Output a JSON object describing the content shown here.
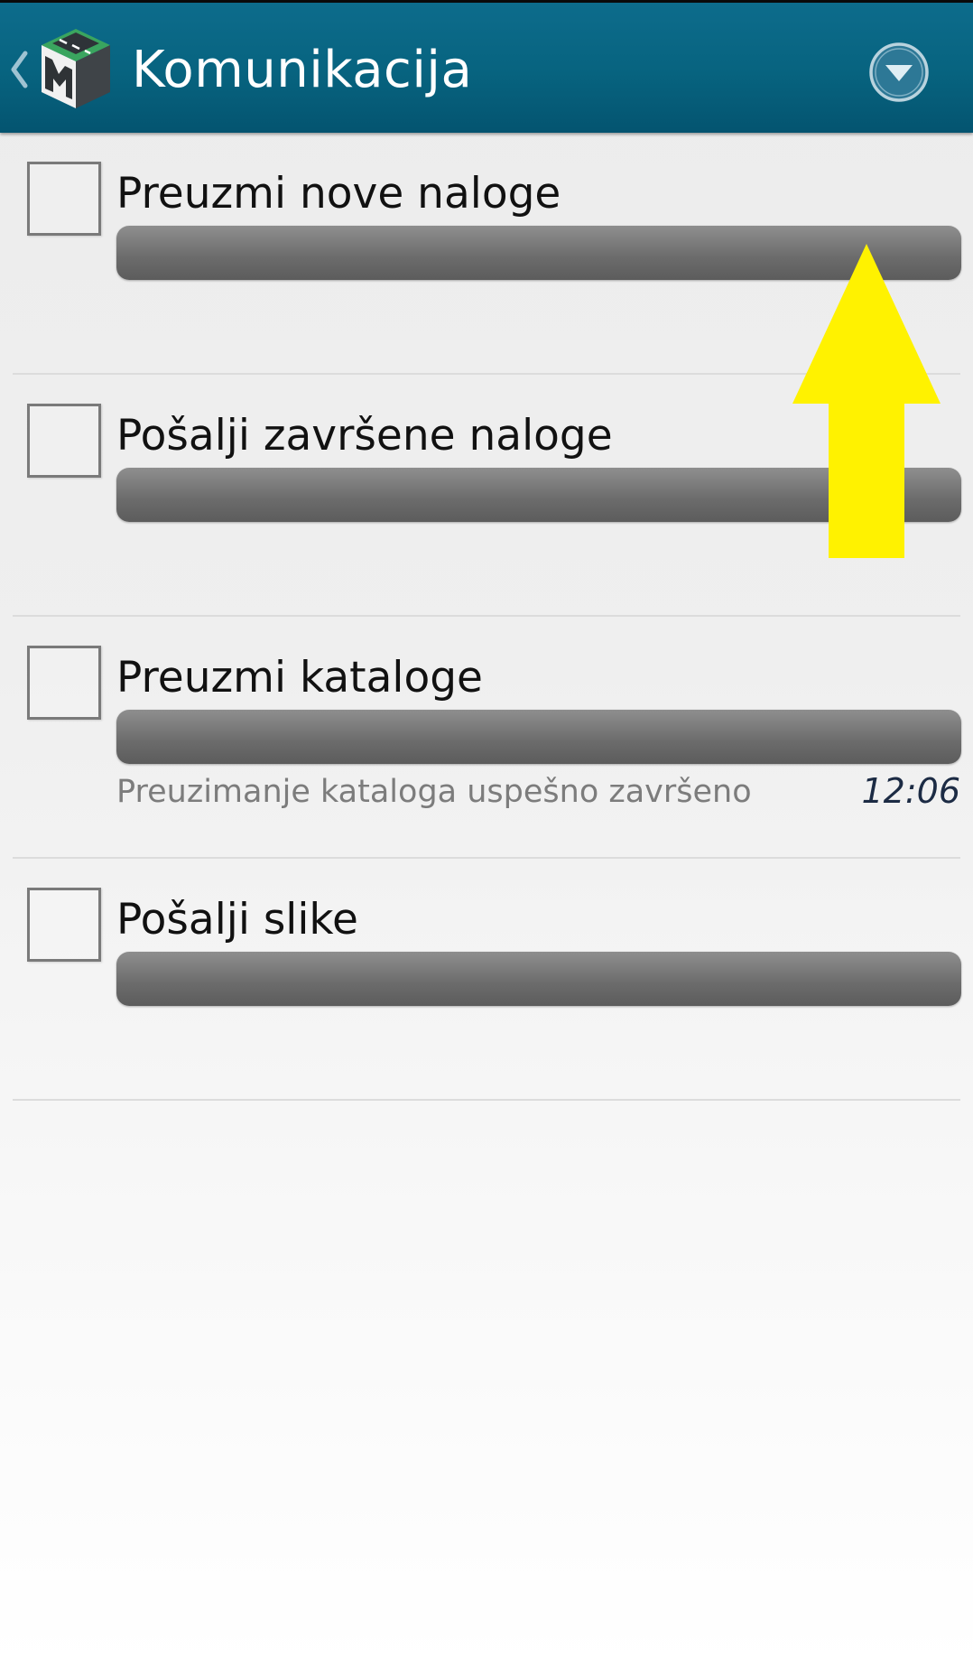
{
  "header": {
    "title": "Komunikacija",
    "back_icon": "chevron-left-icon",
    "logo_icon": "app-logo-icon",
    "menu_icon": "dropdown-circle-icon",
    "background_color": "#06627e"
  },
  "items": [
    {
      "label": "Preuzmi nove naloge",
      "checked": false,
      "progress": 0,
      "status": "",
      "time": ""
    },
    {
      "label": "Pošalji završene naloge",
      "checked": false,
      "progress": 0,
      "status": "",
      "time": ""
    },
    {
      "label": "Preuzmi kataloge",
      "checked": false,
      "progress": 0,
      "status": "Preuzimanje kataloga uspešno završeno",
      "time": "12:06"
    },
    {
      "label": "Pošalji slike",
      "checked": false,
      "progress": 0,
      "status": "",
      "time": ""
    }
  ],
  "annotation": {
    "type": "arrow-up",
    "color": "#fff200"
  }
}
